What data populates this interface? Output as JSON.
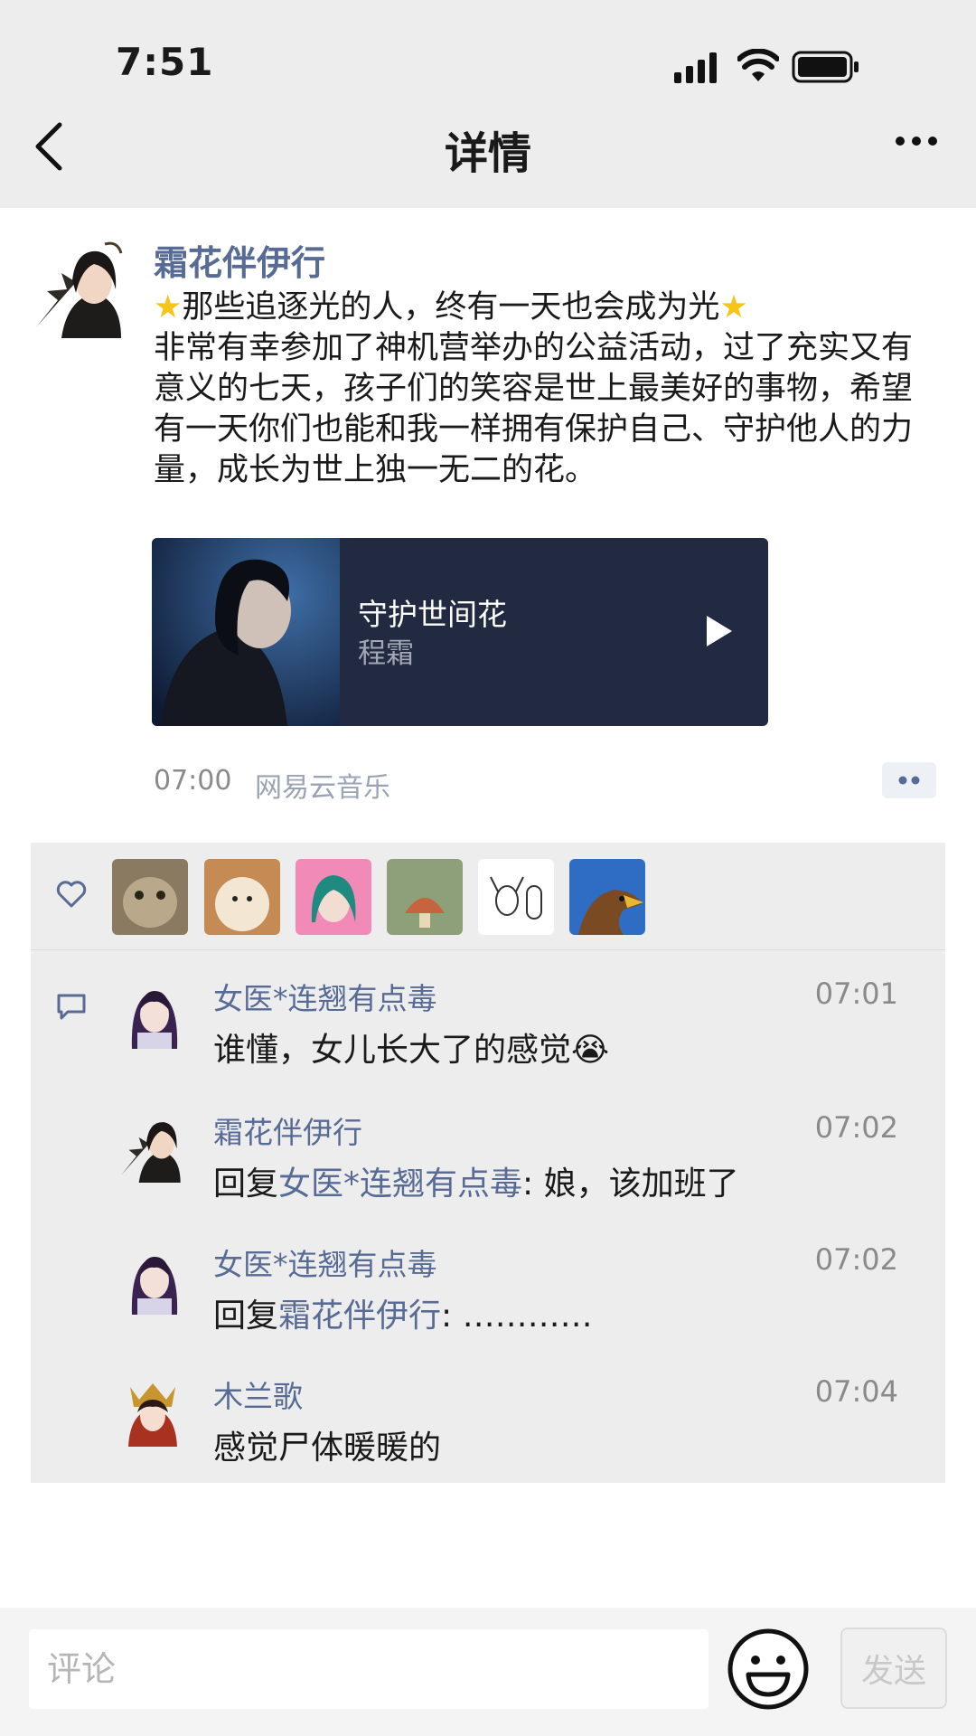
{
  "status_bar": {
    "time": "7:51"
  },
  "nav": {
    "title": "详情",
    "back_icon": "chevron-left-icon",
    "more_icon": "more-dots-icon"
  },
  "post": {
    "author": "霜花伴伊行",
    "headline": "那些追逐光的人，终有一天也会成为光",
    "body_lines": [
      "非常有幸参加了神机营举办的公益活动，过了充实又有",
      "意义的七天，孩子们的笑容是世上最美好的事物，希望",
      "有一天你们也能和我一样拥有保护自己、守护他人的力",
      "量，成长为世上独一无二的花。"
    ],
    "music": {
      "title": "守护世间花",
      "artist": "程霜"
    },
    "time": "07:00",
    "source": "网易云音乐"
  },
  "likes": {
    "count_shown": 6
  },
  "comments": [
    {
      "name": "女医*连翘有点毒",
      "time": "07:01",
      "text": "谁懂，女儿长大了的感觉",
      "emoji": "😭"
    },
    {
      "name": "霜花伴伊行",
      "time": "07:02",
      "prefix": "回复",
      "reply_to": "女医*连翘有点毒",
      "text": ": 娘，该加班了"
    },
    {
      "name": "女医*连翘有点毒",
      "time": "07:02",
      "prefix": "回复",
      "reply_to": "霜花伴伊行",
      "text": ": ………… "
    },
    {
      "name": "木兰歌",
      "time": "07:04",
      "text": "感觉尸体暖暖的"
    }
  ],
  "input": {
    "placeholder": "评论",
    "send_label": "发送"
  },
  "colors": {
    "link": "#576b95",
    "card_bg": "#222a42",
    "panel_bg": "#ededed"
  }
}
